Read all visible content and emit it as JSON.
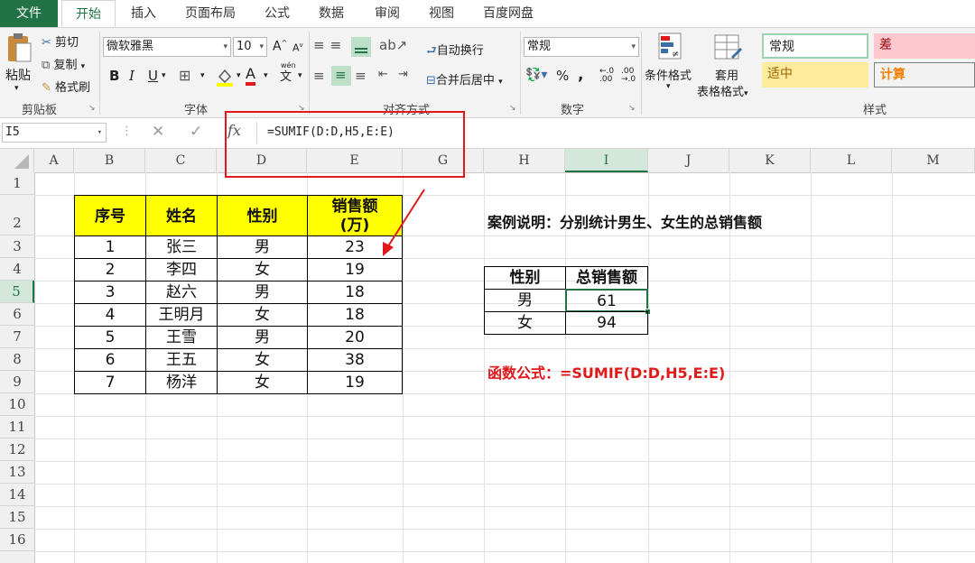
{
  "tabs": [
    "文件",
    "开始",
    "插入",
    "页面布局",
    "公式",
    "数据",
    "审阅",
    "视图",
    "百度网盘"
  ],
  "clipboard": {
    "paste": "粘贴",
    "cut": "剪切",
    "copy": "复制",
    "format_painter": "格式刷",
    "label": "剪贴板"
  },
  "font": {
    "name": "微软雅黑",
    "size": "10",
    "label": "字体",
    "bold": "B",
    "italic": "I",
    "underline": "U",
    "grow": "A",
    "shrink": "A",
    "font_color": "A",
    "phonetic": "文"
  },
  "alignment": {
    "wrap": "自动换行",
    "merge": "合并后居中",
    "label": "对齐方式"
  },
  "number": {
    "format": "常规",
    "percent": "%",
    "comma": ",",
    "label": "数字"
  },
  "styles": {
    "conditional": "条件格式",
    "table_format_1": "套用",
    "table_format_2": "表格格式",
    "label": "样式",
    "normal": "常规",
    "bad": "差",
    "neutral": "适中",
    "calc": "计算"
  },
  "formula_bar": {
    "name_box": "I5",
    "fx": "fx",
    "formula": "=SUMIF(D:D,H5,E:E)"
  },
  "columns": [
    "A",
    "B",
    "C",
    "D",
    "E",
    "G",
    "H",
    "I",
    "J",
    "K",
    "L",
    "M"
  ],
  "rows": [
    "1",
    "2",
    "3",
    "4",
    "5",
    "6",
    "7",
    "8",
    "9",
    "10",
    "11",
    "12",
    "13",
    "14",
    "15",
    "16"
  ],
  "main_table": {
    "headers": [
      "序号",
      "姓名",
      "性别",
      "销售额\n(万)"
    ],
    "rows": [
      [
        "1",
        "张三",
        "男",
        "23"
      ],
      [
        "2",
        "李四",
        "女",
        "19"
      ],
      [
        "3",
        "赵六",
        "男",
        "18"
      ],
      [
        "4",
        "王明月",
        "女",
        "18"
      ],
      [
        "5",
        "王雪",
        "男",
        "20"
      ],
      [
        "6",
        "王五",
        "女",
        "38"
      ],
      [
        "7",
        "杨洋",
        "女",
        "19"
      ]
    ]
  },
  "case_note": "案例说明：分别统计男生、女生的总销售额",
  "summary_table": {
    "headers": [
      "性别",
      "总销售额"
    ],
    "rows": [
      [
        "男",
        "61"
      ],
      [
        "女",
        "94"
      ]
    ]
  },
  "formula_note": "函数公式：=SUMIF(D:D,H5,E:E)",
  "colors": {
    "excel_green": "#217346",
    "header_fill": "#ffff00",
    "annotation_red": "#e0191b",
    "bad_fill": "#ffc7ce",
    "neutral_fill": "#ffeb9c"
  }
}
